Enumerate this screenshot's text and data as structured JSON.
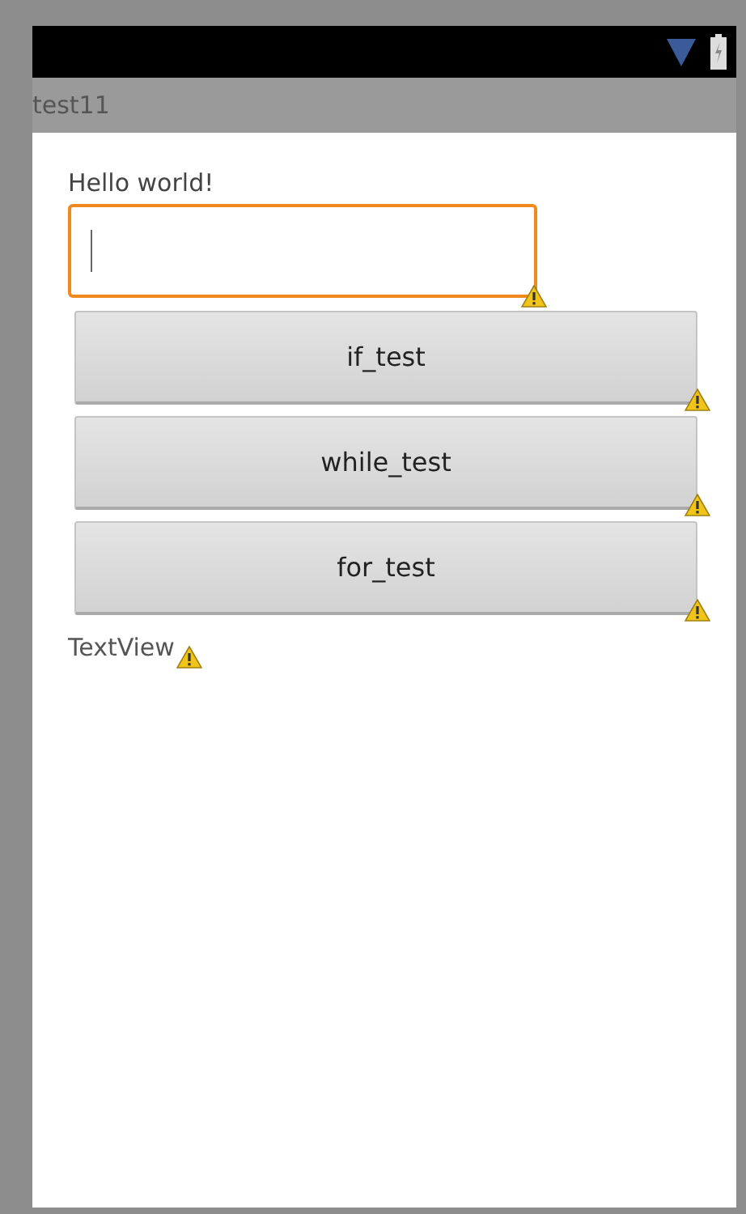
{
  "app_bar": {
    "title": "test11"
  },
  "content": {
    "label": {
      "text": "Hello world!"
    },
    "input": {
      "focused": true,
      "warning": true
    },
    "buttons": [
      {
        "label": "if_test",
        "warning": true
      },
      {
        "label": "while_test",
        "warning": true
      },
      {
        "label": "for_test",
        "warning": true
      }
    ],
    "text_view": {
      "text": "TextView",
      "warning": true
    }
  }
}
